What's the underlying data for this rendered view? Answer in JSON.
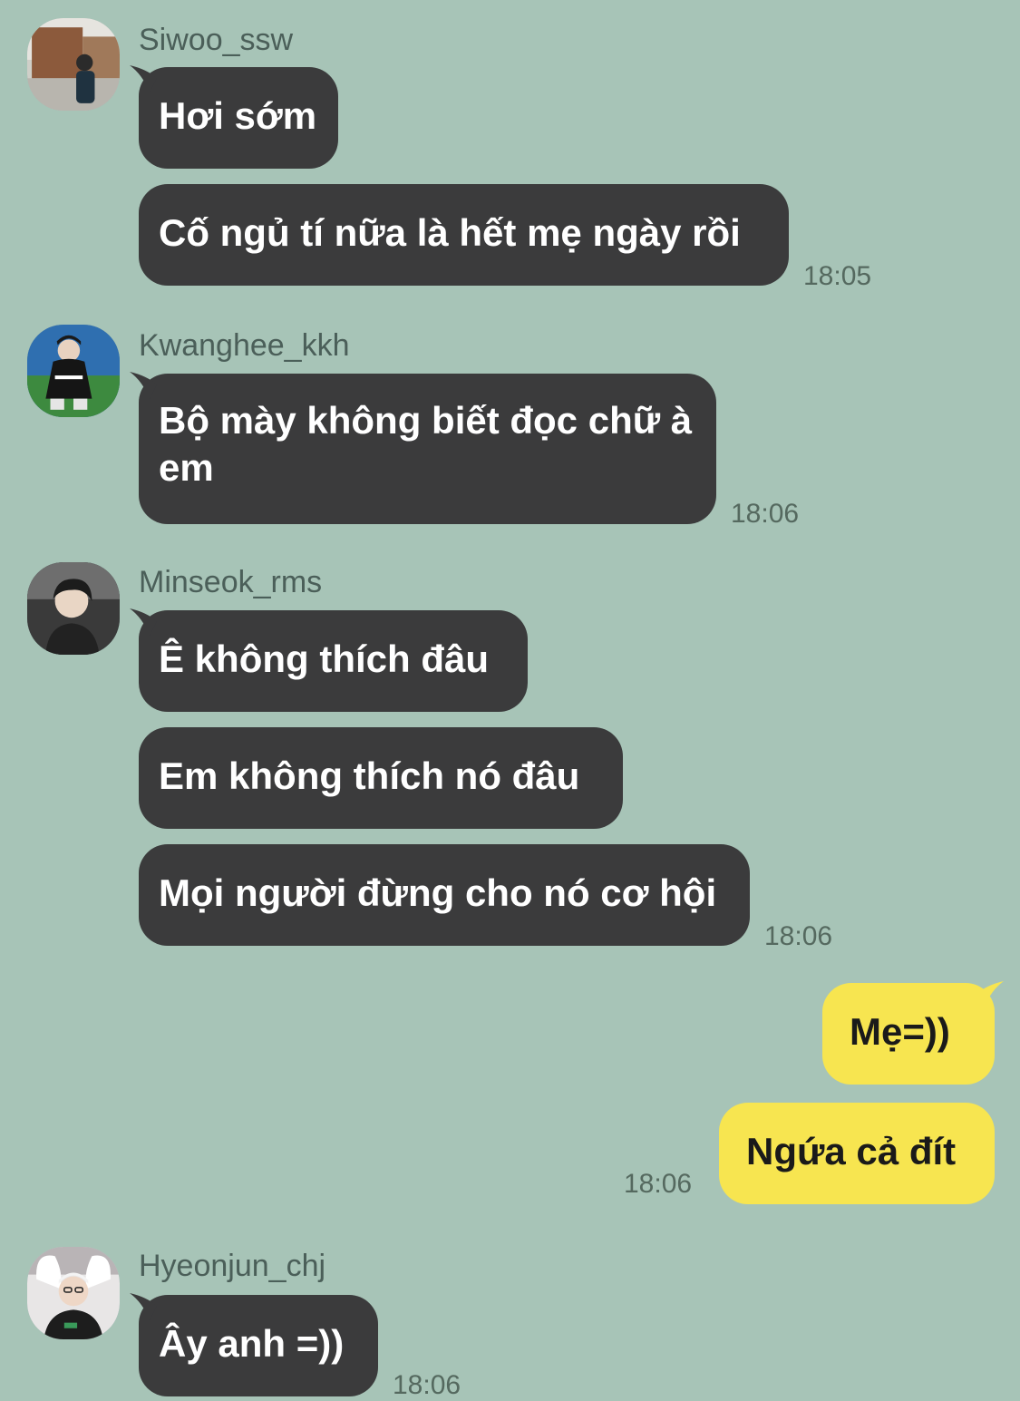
{
  "groups": [
    {
      "sender": "Siwoo_ssw",
      "avatar_icon": "profile-photo-icon",
      "messages": [
        "Hơi sớm",
        "Cố ngủ tí nữa là hết mẹ ngày rồi"
      ],
      "time": "18:05"
    },
    {
      "sender": "Kwanghee_kkh",
      "avatar_icon": "profile-photo-icon",
      "messages": [
        "Bộ mày không biết đọc chữ à em"
      ],
      "time": "18:06"
    },
    {
      "sender": "Minseok_rms",
      "avatar_icon": "profile-photo-icon",
      "messages": [
        "Ê không thích đâu",
        "Em không thích nó đâu",
        "Mọi người đừng cho nó cơ hội"
      ],
      "time": "18:06"
    },
    {
      "sender": "me",
      "messages": [
        "Mẹ=))",
        "Ngứa cả đít"
      ],
      "time": "18:06"
    },
    {
      "sender": "Hyeonjun_chj",
      "avatar_icon": "profile-photo-icon",
      "messages": [
        "Ây anh =))"
      ],
      "time": "18:06"
    }
  ],
  "colors": {
    "background": "#a7c4b7",
    "incoming_bubble": "#3b3b3c",
    "outgoing_bubble": "#f7e550",
    "name_text": "#4b5f59",
    "time_text": "#55695f"
  }
}
